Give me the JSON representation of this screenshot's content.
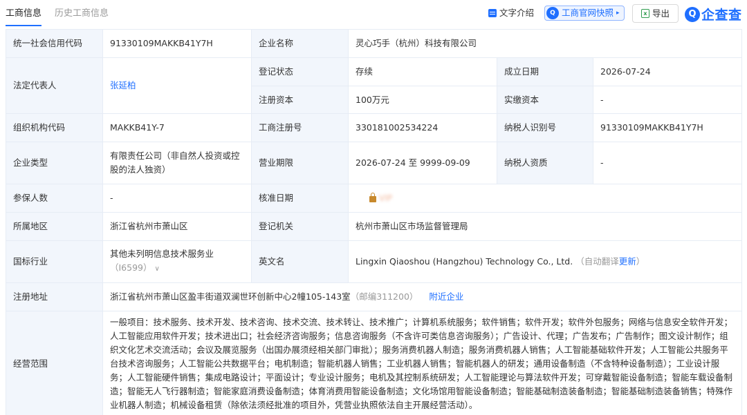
{
  "tabs": {
    "active": "工商信息",
    "inactive": "历史工商信息"
  },
  "toolbar": {
    "text_intro": "文字介绍",
    "snapshot": "工商官网快照",
    "snapshot_arrow": "▸",
    "export": "导出",
    "logo_text": "企查查",
    "logo_glyph": "Q",
    "excel_glyph": "x"
  },
  "labels": {
    "credit_code": "统一社会信用代码",
    "company_name": "企业名称",
    "legal_rep": "法定代表人",
    "reg_status": "登记状态",
    "established": "成立日期",
    "reg_capital": "注册资本",
    "paid_capital": "实缴资本",
    "org_code": "组织机构代码",
    "biz_reg_no": "工商注册号",
    "taxpayer_id": "纳税人识别号",
    "company_type": "企业类型",
    "biz_term": "营业期限",
    "taxpayer_qual": "纳税人资质",
    "insured": "参保人数",
    "approval_date": "核准日期",
    "region": "所属地区",
    "reg_authority": "登记机关",
    "industry": "国标行业",
    "english_name": "英文名",
    "address": "注册地址",
    "scope": "经营范围"
  },
  "values": {
    "credit_code": "91330109MAKKB41Y7H",
    "company_name": "灵心巧手（杭州）科技有限公司",
    "legal_rep": "张延柏",
    "reg_status": "存续",
    "established": "2026-07-24",
    "reg_capital": "100万元",
    "paid_capital": "-",
    "org_code": "MAKKB41Y-7",
    "biz_reg_no": "330181002534224",
    "taxpayer_id": "91330109MAKKB41Y7H",
    "company_type": "有限责任公司（非自然人投资或控股的法人独资）",
    "biz_term": "2026-07-24 至 9999-09-09",
    "taxpayer_qual": "-",
    "insured": "-",
    "approval_date_masked": "VIP",
    "region": "浙江省杭州市萧山区",
    "reg_authority": "杭州市萧山区市场监督管理局",
    "industry": "其他未列明信息技术服务业",
    "industry_code": "（I6599）",
    "industry_chevron": "∨",
    "english_name": "Lingxin Qiaoshou (Hangzhou) Technology Co., Ltd.",
    "english_note": "（自动翻译",
    "english_update": "更新",
    "english_close": "）",
    "address": "浙江省杭州市萧山区盈丰街道双澜世环创新中心2幢105-143室",
    "postcode": "（邮编311200）",
    "nearby": "附近企业",
    "scope": "一般项目：技术服务、技术开发、技术咨询、技术交流、技术转让、技术推广；计算机系统服务；软件销售；软件开发；软件外包服务；网络与信息安全软件开发；人工智能应用软件开发；技术进出口；社会经济咨询服务；信息咨询服务（不含许可类信息咨询服务）；广告设计、代理；广告发布；广告制作；图文设计制作；组织文化艺术交流活动；会议及展览服务（出国办展须经相关部门审批）；服务消费机器人制造；服务消费机器人销售；人工智能基础软件开发；人工智能公共服务平台技术咨询服务；人工智能公共数据平台；电机制造；智能机器人销售；工业机器人销售；智能机器人的研发；通用设备制造（不含特种设备制造）；工业设计服务；人工智能硬件销售；集成电路设计；平面设计；专业设计服务；电机及其控制系统研发；人工智能理论与算法软件开发；可穿戴智能设备制造；智能车载设备制造；智能无人飞行器制造；智能家庭消费设备制造；体育消费用智能设备制造；文化场馆用智能设备制造；智能基础制造装备制造；智能基础制造装备销售；特殊作业机器人制造；机械设备租赁（除依法须经批准的项目外，凭营业执照依法自主开展经营活动）。"
  },
  "colors": {
    "accent": "#1f6fff",
    "label_bg": "#f2f6fc",
    "border": "#e6ecf5"
  }
}
